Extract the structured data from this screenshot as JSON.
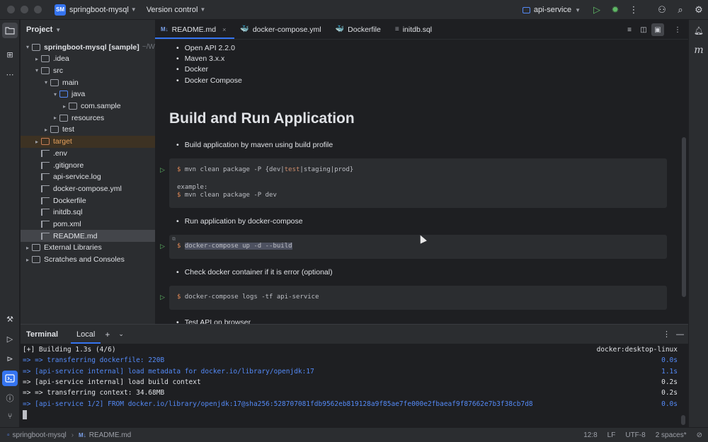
{
  "titlebar": {
    "project_badge": "SM",
    "project_name": "springboot-mysql",
    "vcs_label": "Version control",
    "run_config": "api-service",
    "icons": [
      "run-icon",
      "debug-icon",
      "more-icon",
      "add-user-icon",
      "search-icon",
      "settings-icon"
    ]
  },
  "left_strip": {
    "icons": [
      "project-icon",
      "structure-icon",
      "more-tools-icon",
      "build-icon",
      "run-icon",
      "services-icon",
      "terminal-icon",
      "problems-icon",
      "git-icon"
    ]
  },
  "right_strip": {
    "icons": [
      "notifications-icon",
      "maven-icon"
    ]
  },
  "project": {
    "header": "Project",
    "tree": [
      {
        "label": "springboot-mysql [sample]",
        "path": "~/Worksp",
        "depth": 0,
        "arrow": "▾",
        "icon": "folder",
        "bold": true
      },
      {
        "label": ".idea",
        "depth": 1,
        "arrow": "▸",
        "icon": "folder"
      },
      {
        "label": "src",
        "depth": 1,
        "arrow": "▾",
        "icon": "folder"
      },
      {
        "label": "main",
        "depth": 2,
        "arrow": "▾",
        "icon": "folder"
      },
      {
        "label": "java",
        "depth": 3,
        "arrow": "▾",
        "icon": "folder-blue"
      },
      {
        "label": "com.sample",
        "depth": 4,
        "arrow": "▸",
        "icon": "folder"
      },
      {
        "label": "resources",
        "depth": 3,
        "arrow": "▸",
        "icon": "folder"
      },
      {
        "label": "test",
        "depth": 2,
        "arrow": "▸",
        "icon": "folder"
      },
      {
        "label": "target",
        "depth": 1,
        "arrow": "▸",
        "icon": "folder-orange",
        "orange": true
      },
      {
        "label": ".env",
        "depth": 1,
        "arrow": "",
        "icon": "file"
      },
      {
        "label": ".gitignore",
        "depth": 1,
        "arrow": "",
        "icon": "file"
      },
      {
        "label": "api-service.log",
        "depth": 1,
        "arrow": "",
        "icon": "file"
      },
      {
        "label": "docker-compose.yml",
        "depth": 1,
        "arrow": "",
        "icon": "file"
      },
      {
        "label": "Dockerfile",
        "depth": 1,
        "arrow": "",
        "icon": "file"
      },
      {
        "label": "initdb.sql",
        "depth": 1,
        "arrow": "",
        "icon": "file"
      },
      {
        "label": "pom.xml",
        "depth": 1,
        "arrow": "",
        "icon": "file"
      },
      {
        "label": "README.md",
        "depth": 1,
        "arrow": "",
        "icon": "file",
        "selected": true
      },
      {
        "label": "External Libraries",
        "depth": 0,
        "arrow": "▸",
        "icon": "folder"
      },
      {
        "label": "Scratches and Consoles",
        "depth": 0,
        "arrow": "▸",
        "icon": "folder"
      }
    ]
  },
  "editor_tabs": [
    {
      "badge": "M↓",
      "label": "README.md",
      "active": true,
      "close": "×"
    },
    {
      "badge": "🐳",
      "label": "docker-compose.yml"
    },
    {
      "badge": "🐳",
      "label": "Dockerfile"
    },
    {
      "badge": "≡",
      "label": "initdb.sql"
    }
  ],
  "editor": {
    "top_bullets": [
      "Open API 2.2.0",
      "Maven 3.x.x",
      "Docker",
      "Docker Compose"
    ],
    "heading": "Build and Run Application",
    "bullet_build": "Build application by maven using build profile",
    "code1": {
      "line1_prefix": "$ ",
      "line1_a": "mvn clean package -P {dev|",
      "line1_kw": "test",
      "line1_b": "|staging|prod}",
      "line2": "example:",
      "line3_prefix": "$ ",
      "line3": "mvn clean package -P dev"
    },
    "bullet_run": "Run application by docker-compose",
    "code2": {
      "prefix": "$ ",
      "command": "docker-compose up -d --build"
    },
    "bullet_check": "Check docker container if it is error (optional)",
    "code3": {
      "prefix": "$ ",
      "command": "docker-compose logs -tf api-service"
    },
    "bullet_test": "Test API on browser"
  },
  "terminal": {
    "title": "Terminal",
    "tab": "Local",
    "lines": [
      {
        "text": "[+] Building 1.3s (4/6)",
        "time": "docker:desktop-linux",
        "blue": false
      },
      {
        "text": " => => transferring dockerfile: 220B",
        "time": "0.0s",
        "blue": true
      },
      {
        "text": " => [api-service internal] load metadata for docker.io/library/openjdk:17",
        "time": "1.1s",
        "blue": true
      },
      {
        "text": " => [api-service internal] load build context",
        "time": "0.2s",
        "blue": false
      },
      {
        "text": " => => transferring context: 34.68MB",
        "time": "0.2s",
        "blue": false
      },
      {
        "text": " => [api-service 1/2] FROM docker.io/library/openjdk:17@sha256:528707081fdb9562eb819128a9f85ae7fe000e2fbaeaf9f87662e7b3f38cb7d8",
        "time": "0.0s",
        "blue": true
      }
    ]
  },
  "statusbar": {
    "project": "springboot-mysql",
    "file_badge": "M↓",
    "file": "README.md",
    "position": "12:8",
    "line_sep": "LF",
    "encoding": "UTF-8",
    "indent": "2 spaces*"
  }
}
